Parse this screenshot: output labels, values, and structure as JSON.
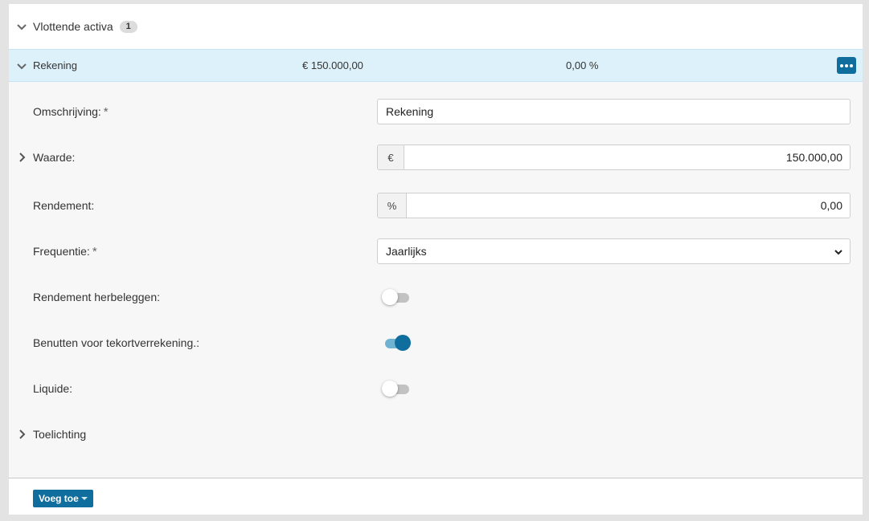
{
  "section": {
    "title": "Vlottende activa",
    "count": "1"
  },
  "item": {
    "name": "Rekening",
    "amount": "€ 150.000,00",
    "percentage": "0,00 %"
  },
  "form": {
    "omschrijving": {
      "label": "Omschrijving:",
      "required_mark": "*",
      "value": "Rekening"
    },
    "waarde": {
      "label": "Waarde:",
      "prefix": "€",
      "value": "150.000,00"
    },
    "rendement": {
      "label": "Rendement:",
      "prefix": "%",
      "value": "0,00"
    },
    "frequentie": {
      "label": "Frequentie:",
      "required_mark": "*",
      "selected": "Jaarlijks"
    },
    "rendement_herbeleggen": {
      "label": "Rendement herbeleggen:",
      "on": false
    },
    "benutten": {
      "label": "Benutten voor tekortverrekening.:",
      "on": true
    },
    "liquide": {
      "label": "Liquide:",
      "on": false
    },
    "toelichting": {
      "label": "Toelichting"
    }
  },
  "footer": {
    "add_label": "Voeg toe"
  },
  "colors": {
    "accent": "#0f6e9e",
    "row_highlight": "#ddf1fb",
    "toggle_on_track": "#6fb2d2",
    "toggle_off_track": "#c2c2c2"
  }
}
